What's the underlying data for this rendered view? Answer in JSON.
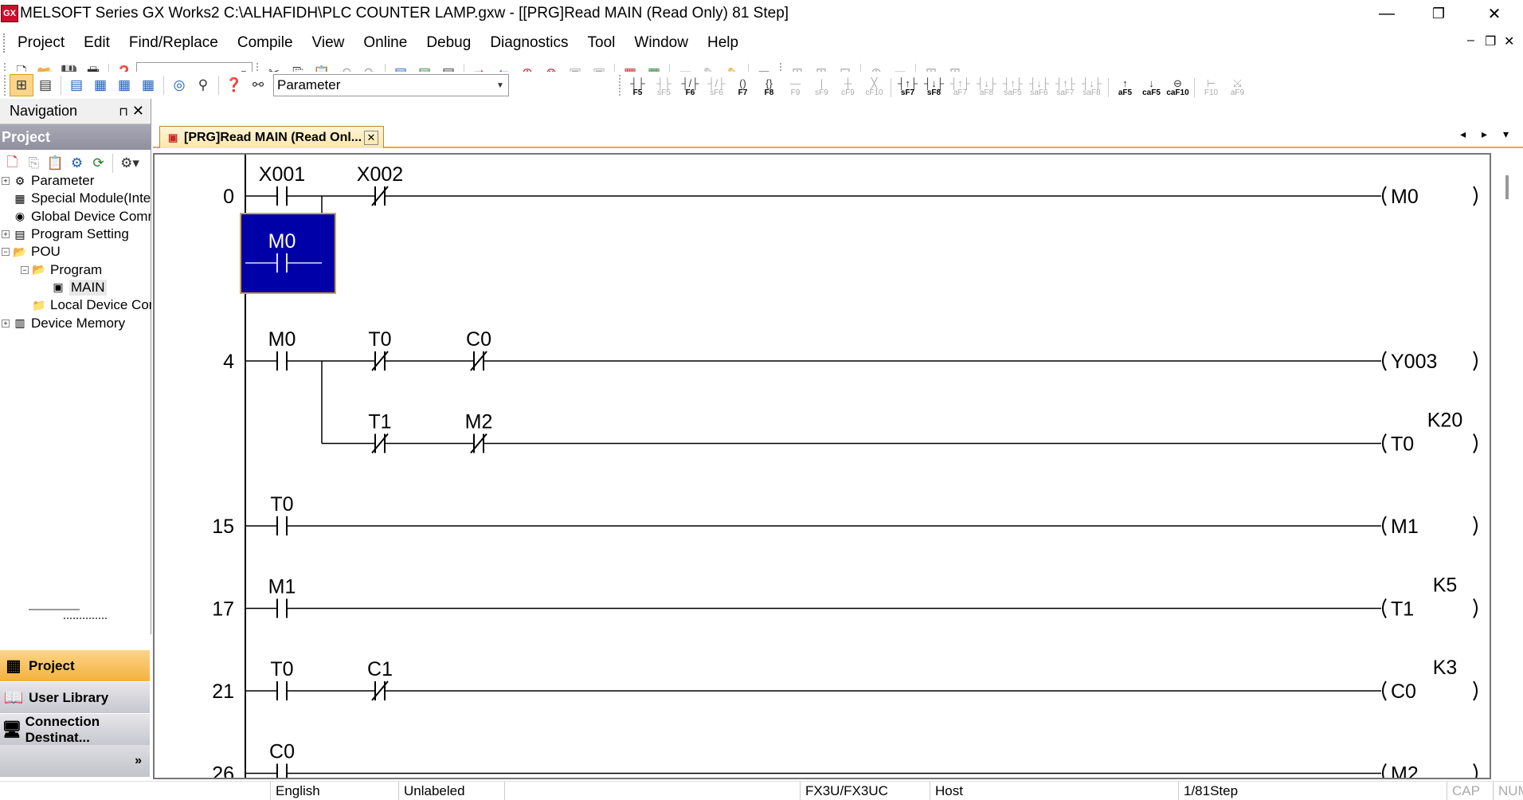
{
  "window": {
    "icon": "GX",
    "title": "MELSOFT Series GX Works2 C:\\ALHAFIDH\\PLC COUNTER LAMP.gxw - [[PRG]Read MAIN (Read Only) 81 Step]",
    "minimize": "—",
    "maximize": "❐",
    "close": "✕"
  },
  "menu": {
    "items": [
      "Project",
      "Edit",
      "Find/Replace",
      "Compile",
      "View",
      "Online",
      "Debug",
      "Diagnostics",
      "Tool",
      "Window",
      "Help"
    ],
    "mdi_min": "–",
    "mdi_restore": "❐",
    "mdi_close": "✕"
  },
  "toolbar1": {
    "combo_value": ""
  },
  "toolbar2": {
    "combo_value": "Parameter",
    "fkeys": [
      {
        "sym": "┤├",
        "label": "F5",
        "dim": false
      },
      {
        "sym": "┤├",
        "label": "sF5",
        "dim": true
      },
      {
        "sym": "┤/├",
        "label": "F6",
        "dim": false
      },
      {
        "sym": "┤/├",
        "label": "sF6",
        "dim": true
      },
      {
        "sym": "()",
        "label": "F7",
        "dim": false
      },
      {
        "sym": "{}",
        "label": "F8",
        "dim": false
      },
      {
        "sym": "—",
        "label": "F9",
        "dim": true
      },
      {
        "sym": "|",
        "label": "sF9",
        "dim": true
      },
      {
        "sym": "┼",
        "label": "cF9",
        "dim": true
      },
      {
        "sym": "╳",
        "label": "cF10",
        "dim": true
      },
      {
        "sym": "┤↑├",
        "label": "sF7",
        "dim": false
      },
      {
        "sym": "┤↓├",
        "label": "sF8",
        "dim": false
      },
      {
        "sym": "┤↑├",
        "label": "aF7",
        "dim": true
      },
      {
        "sym": "┤↓├",
        "label": "aF8",
        "dim": true
      },
      {
        "sym": "┤↑├",
        "label": "saF5",
        "dim": true
      },
      {
        "sym": "┤↓├",
        "label": "saF6",
        "dim": true
      },
      {
        "sym": "┤↑├",
        "label": "saF7",
        "dim": true
      },
      {
        "sym": "┤↓├",
        "label": "saF8",
        "dim": true
      },
      {
        "sym": "↑",
        "label": "aF5",
        "dim": false
      },
      {
        "sym": "↓",
        "label": "caF5",
        "dim": false
      },
      {
        "sym": "⊖",
        "label": "caF10",
        "dim": false
      },
      {
        "sym": "⊢",
        "label": "F10",
        "dim": true
      },
      {
        "sym": "⤩",
        "label": "aF9",
        "dim": true
      }
    ]
  },
  "navigation": {
    "header": "Navigation",
    "pin": "⊓",
    "close": "✕",
    "project_header": "Project",
    "tree": [
      {
        "label": "Parameter",
        "indent": 0,
        "expander": "+",
        "icon": "parameter-icon",
        "glyph": "⚙"
      },
      {
        "label": "Special Module(Intelligent",
        "indent": 0,
        "expander": "",
        "icon": "module-icon",
        "glyph": "▦"
      },
      {
        "label": "Global Device Comment",
        "indent": 0,
        "expander": "",
        "icon": "global-comment-icon",
        "glyph": "◉"
      },
      {
        "label": "Program Setting",
        "indent": 0,
        "expander": "+",
        "icon": "program-setting-icon",
        "glyph": "▤"
      },
      {
        "label": "POU",
        "indent": 0,
        "expander": "−",
        "icon": "pou-folder-icon",
        "glyph": "📂"
      },
      {
        "label": "Program",
        "indent": 1,
        "expander": "−",
        "icon": "program-folder-icon",
        "glyph": "📂"
      },
      {
        "label": "MAIN",
        "indent": 2,
        "expander": "",
        "icon": "ladder-program-icon",
        "glyph": "▣"
      },
      {
        "label": "Local Device Comment",
        "indent": 1,
        "expander": "",
        "icon": "local-comment-icon",
        "glyph": "📁"
      },
      {
        "label": "Device Memory",
        "indent": 0,
        "expander": "+",
        "icon": "device-memory-icon",
        "glyph": "▥"
      }
    ],
    "tabs": [
      {
        "label": "Project",
        "icon": "project-tab-icon",
        "active": true
      },
      {
        "label": "User Library",
        "icon": "user-library-icon",
        "active": false
      },
      {
        "label": "Connection Destinat...",
        "icon": "connection-destination-icon",
        "active": false
      }
    ],
    "more": "»"
  },
  "editor": {
    "tab_label": "[PRG]Read MAIN (Read Onl...",
    "tab_close": "✕",
    "nav_arrows": "◂ ▸ ▾"
  },
  "ladder": {
    "selection_color": "#0000a8",
    "rungs": [
      {
        "step": "0",
        "contacts": [
          {
            "dev": "X001",
            "type": "NO"
          },
          {
            "dev": "X002",
            "type": "NC"
          }
        ],
        "coil": "M0",
        "coil_setting": "",
        "branch_contacts": [
          {
            "dev": "M0",
            "type": "NO",
            "selected": true
          }
        ]
      },
      {
        "step": "4",
        "contacts": [
          {
            "dev": "M0",
            "type": "NO"
          },
          {
            "dev": "T0",
            "type": "NC"
          },
          {
            "dev": "C0",
            "type": "NC"
          }
        ],
        "coil": "Y003",
        "coil_setting": ""
      },
      {
        "step": "",
        "contacts": [
          {
            "dev": "T1",
            "type": "NC"
          },
          {
            "dev": "M2",
            "type": "NC"
          }
        ],
        "coil": "T0",
        "coil_setting": "K20"
      },
      {
        "step": "15",
        "contacts": [
          {
            "dev": "T0",
            "type": "NO"
          }
        ],
        "coil": "M1",
        "coil_setting": ""
      },
      {
        "step": "17",
        "contacts": [
          {
            "dev": "M1",
            "type": "NO"
          }
        ],
        "coil": "T1",
        "coil_setting": "K5"
      },
      {
        "step": "21",
        "contacts": [
          {
            "dev": "T0",
            "type": "NO"
          },
          {
            "dev": "C1",
            "type": "NC"
          }
        ],
        "coil": "C0",
        "coil_setting": "K3"
      },
      {
        "step": "26",
        "contacts": [
          {
            "dev": "C0",
            "type": "NO"
          }
        ],
        "coil": "M2",
        "coil_setting": ""
      }
    ]
  },
  "status": {
    "language": "English",
    "label_state": "Unlabeled",
    "plc_type": "FX3U/FX3UC",
    "connection": "Host",
    "step": "1/81Step",
    "cap": "CAP",
    "num": "NUM"
  }
}
